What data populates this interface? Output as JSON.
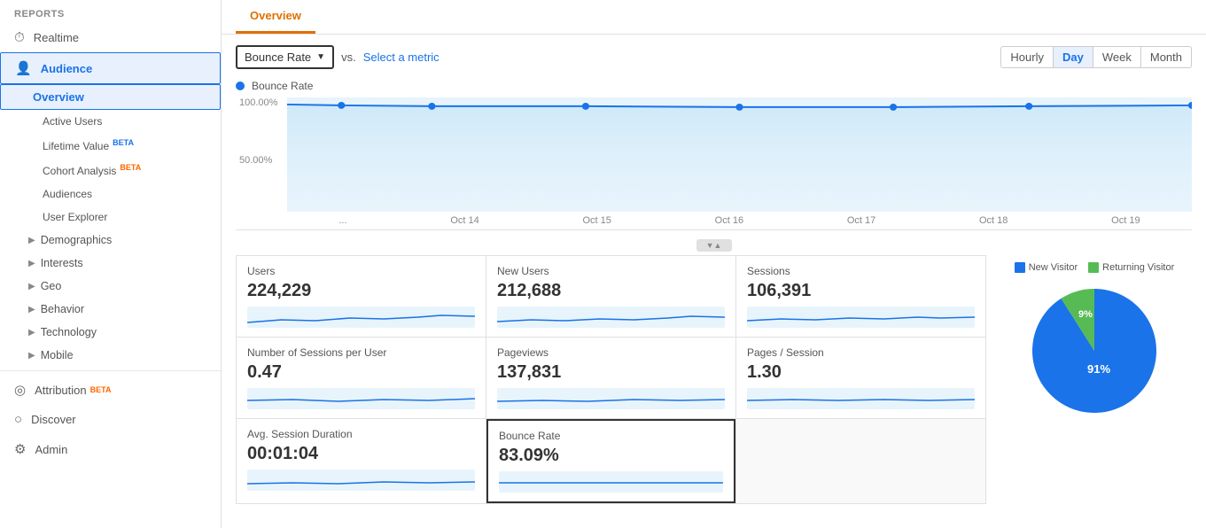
{
  "sidebar": {
    "reports_label": "REPORTS",
    "items": [
      {
        "id": "realtime",
        "label": "Realtime",
        "icon": "⏱",
        "expandable": true
      },
      {
        "id": "audience",
        "label": "Audience",
        "icon": "👤",
        "active": true,
        "expandable": true
      },
      {
        "id": "overview",
        "label": "Overview",
        "selected": true
      },
      {
        "id": "active-users",
        "label": "Active Users"
      },
      {
        "id": "lifetime-value",
        "label": "Lifetime Value",
        "beta": "BETA"
      },
      {
        "id": "cohort-analysis",
        "label": "Cohort Analysis",
        "beta": "BETA",
        "beta_color": "orange"
      },
      {
        "id": "audiences",
        "label": "Audiences"
      },
      {
        "id": "user-explorer",
        "label": "User Explorer"
      },
      {
        "id": "demographics",
        "label": "Demographics",
        "expandable": true
      },
      {
        "id": "interests",
        "label": "Interests",
        "expandable": true
      },
      {
        "id": "geo",
        "label": "Geo",
        "expandable": true
      },
      {
        "id": "behavior",
        "label": "Behavior",
        "expandable": true
      },
      {
        "id": "technology",
        "label": "Technology",
        "expandable": true
      },
      {
        "id": "mobile",
        "label": "Mobile",
        "expandable": true
      },
      {
        "id": "attribution",
        "label": "Attribution",
        "beta": "BETA",
        "beta_color": "orange",
        "icon": "◎"
      },
      {
        "id": "discover",
        "label": "Discover",
        "icon": "○"
      },
      {
        "id": "admin",
        "label": "Admin",
        "icon": "⚙"
      }
    ]
  },
  "tabs": [
    {
      "id": "overview",
      "label": "Overview",
      "active": true
    }
  ],
  "controls": {
    "metric_dropdown_label": "Bounce Rate",
    "vs_label": "vs.",
    "select_metric_label": "Select a metric",
    "time_buttons": [
      "Hourly",
      "Day",
      "Week",
      "Month"
    ],
    "active_time": "Day"
  },
  "chart": {
    "legend_label": "Bounce Rate",
    "legend_color": "#1a73e8",
    "y_labels": [
      "100.00%",
      "50.00%"
    ],
    "x_labels": [
      "...",
      "Oct 14",
      "Oct 15",
      "Oct 16",
      "Oct 17",
      "Oct 18",
      "Oct 19"
    ]
  },
  "metrics": [
    {
      "id": "users",
      "title": "Users",
      "value": "224,229"
    },
    {
      "id": "new-users",
      "title": "New Users",
      "value": "212,688"
    },
    {
      "id": "sessions",
      "title": "Sessions",
      "value": "106,391"
    },
    {
      "id": "sessions-per-user",
      "title": "Number of Sessions per User",
      "value": "0.47"
    },
    {
      "id": "pageviews",
      "title": "Pageviews",
      "value": "137,831"
    },
    {
      "id": "pages-session",
      "title": "Pages / Session",
      "value": "1.30"
    },
    {
      "id": "avg-session-duration",
      "title": "Avg. Session Duration",
      "value": "00:01:04"
    },
    {
      "id": "bounce-rate",
      "title": "Bounce Rate",
      "value": "83.09%",
      "selected": true
    }
  ],
  "pie_chart": {
    "segments": [
      {
        "id": "new-visitor",
        "label": "New Visitor",
        "color": "#1a73e8",
        "value": 91,
        "percent": "91%"
      },
      {
        "id": "returning-visitor",
        "label": "Returning Visitor",
        "color": "#57bb55",
        "value": 9,
        "percent": "9%"
      }
    ]
  }
}
